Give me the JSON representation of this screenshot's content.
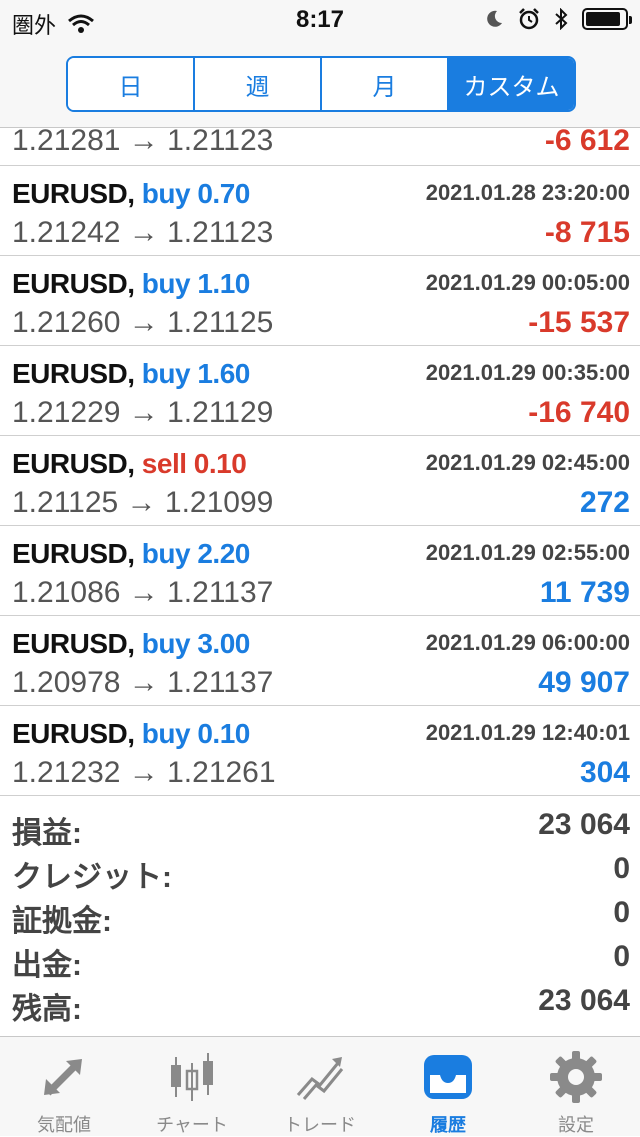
{
  "status_bar": {
    "carrier": "圏外",
    "time": "8:17"
  },
  "segments": [
    {
      "label": "日",
      "active": false
    },
    {
      "label": "週",
      "active": false
    },
    {
      "label": "月",
      "active": false
    },
    {
      "label": "カスタム",
      "active": true
    }
  ],
  "partial_row": {
    "prices": "1.21281 → 1.21123",
    "profit": "-6 612"
  },
  "deals": [
    {
      "symbol": "EURUSD,",
      "direction": "buy",
      "volume": "0.70",
      "time": "2021.01.28 23:20:00",
      "prices": "1.21242 → 1.21123",
      "profit": "-8 715"
    },
    {
      "symbol": "EURUSD,",
      "direction": "buy",
      "volume": "1.10",
      "time": "2021.01.29 00:05:00",
      "prices": "1.21260 → 1.21125",
      "profit": "-15 537"
    },
    {
      "symbol": "EURUSD,",
      "direction": "buy",
      "volume": "1.60",
      "time": "2021.01.29 00:35:00",
      "prices": "1.21229 → 1.21129",
      "profit": "-16 740"
    },
    {
      "symbol": "EURUSD,",
      "direction": "sell",
      "volume": "0.10",
      "time": "2021.01.29 02:45:00",
      "prices": "1.21125 → 1.21099",
      "profit": "272"
    },
    {
      "symbol": "EURUSD,",
      "direction": "buy",
      "volume": "2.20",
      "time": "2021.01.29 02:55:00",
      "prices": "1.21086 → 1.21137",
      "profit": "11 739"
    },
    {
      "symbol": "EURUSD,",
      "direction": "buy",
      "volume": "3.00",
      "time": "2021.01.29 06:00:00",
      "prices": "1.20978 → 1.21137",
      "profit": "49 907"
    },
    {
      "symbol": "EURUSD,",
      "direction": "buy",
      "volume": "0.10",
      "time": "2021.01.29 12:40:01",
      "prices": "1.21232 → 1.21261",
      "profit": "304"
    }
  ],
  "summary": [
    {
      "label": "損益:",
      "value": "23 064"
    },
    {
      "label": "クレジット:",
      "value": "0"
    },
    {
      "label": "証拠金:",
      "value": "0"
    },
    {
      "label": "出金:",
      "value": "0"
    },
    {
      "label": "残高:",
      "value": "23 064"
    }
  ],
  "tabs": [
    {
      "label": "気配値",
      "icon": "quotes-arrows-icon",
      "active": false
    },
    {
      "label": "チャート",
      "icon": "candlestick-chart-icon",
      "active": false
    },
    {
      "label": "トレード",
      "icon": "trade-trend-icon",
      "active": false
    },
    {
      "label": "履歴",
      "icon": "history-inbox-icon",
      "active": true
    },
    {
      "label": "設定",
      "icon": "settings-gear-icon",
      "active": false
    }
  ],
  "colors": {
    "accent": "#1a7de0",
    "negative": "#d93a2b"
  }
}
